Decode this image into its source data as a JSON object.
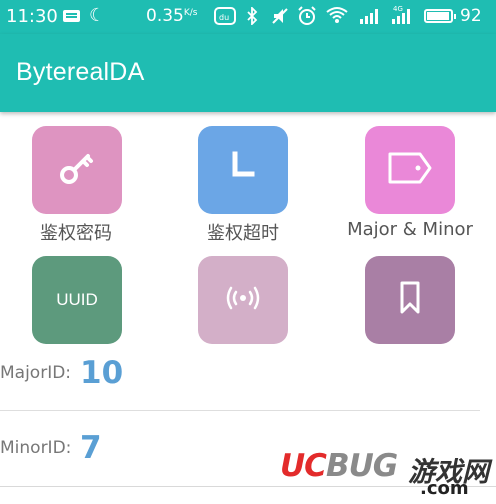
{
  "status_bar": {
    "time": "11:30",
    "speed_value": "0.35",
    "speed_unit": "K/s",
    "network_type": "4G",
    "battery_level": "92",
    "icons": [
      "keyboard-icon",
      "moon-icon",
      "du-app-icon",
      "bluetooth-icon",
      "mute-icon",
      "alarm-icon",
      "wifi-icon",
      "signal-icon",
      "signal-4g-icon",
      "battery-icon"
    ]
  },
  "app_bar": {
    "title": "ByterealDA"
  },
  "tiles": [
    {
      "label": "鉴权密码",
      "icon": "key-icon",
      "color": "#de94c1"
    },
    {
      "label": "鉴权超时",
      "icon": "clock-hand-icon",
      "color": "#6ba6e6"
    },
    {
      "label": "Major & Minor",
      "icon": "tag-icon",
      "color": "#ea88d8"
    },
    {
      "label": "UUID",
      "icon": "uuid-text-icon",
      "color": "#5d9a7d"
    },
    {
      "label": "",
      "icon": "broadcast-icon",
      "color": "#d3afc8"
    },
    {
      "label": "",
      "icon": "bookmark-icon",
      "color": "#a97fa5"
    }
  ],
  "fields": {
    "major_label": "MajorID:",
    "major_value": "10",
    "minor_label": "MinorID:",
    "minor_value": "7"
  },
  "watermark": {
    "brand_uc": "UC",
    "brand_bug": "BUG",
    "chinese": "游戏网",
    "domain": ".com"
  }
}
